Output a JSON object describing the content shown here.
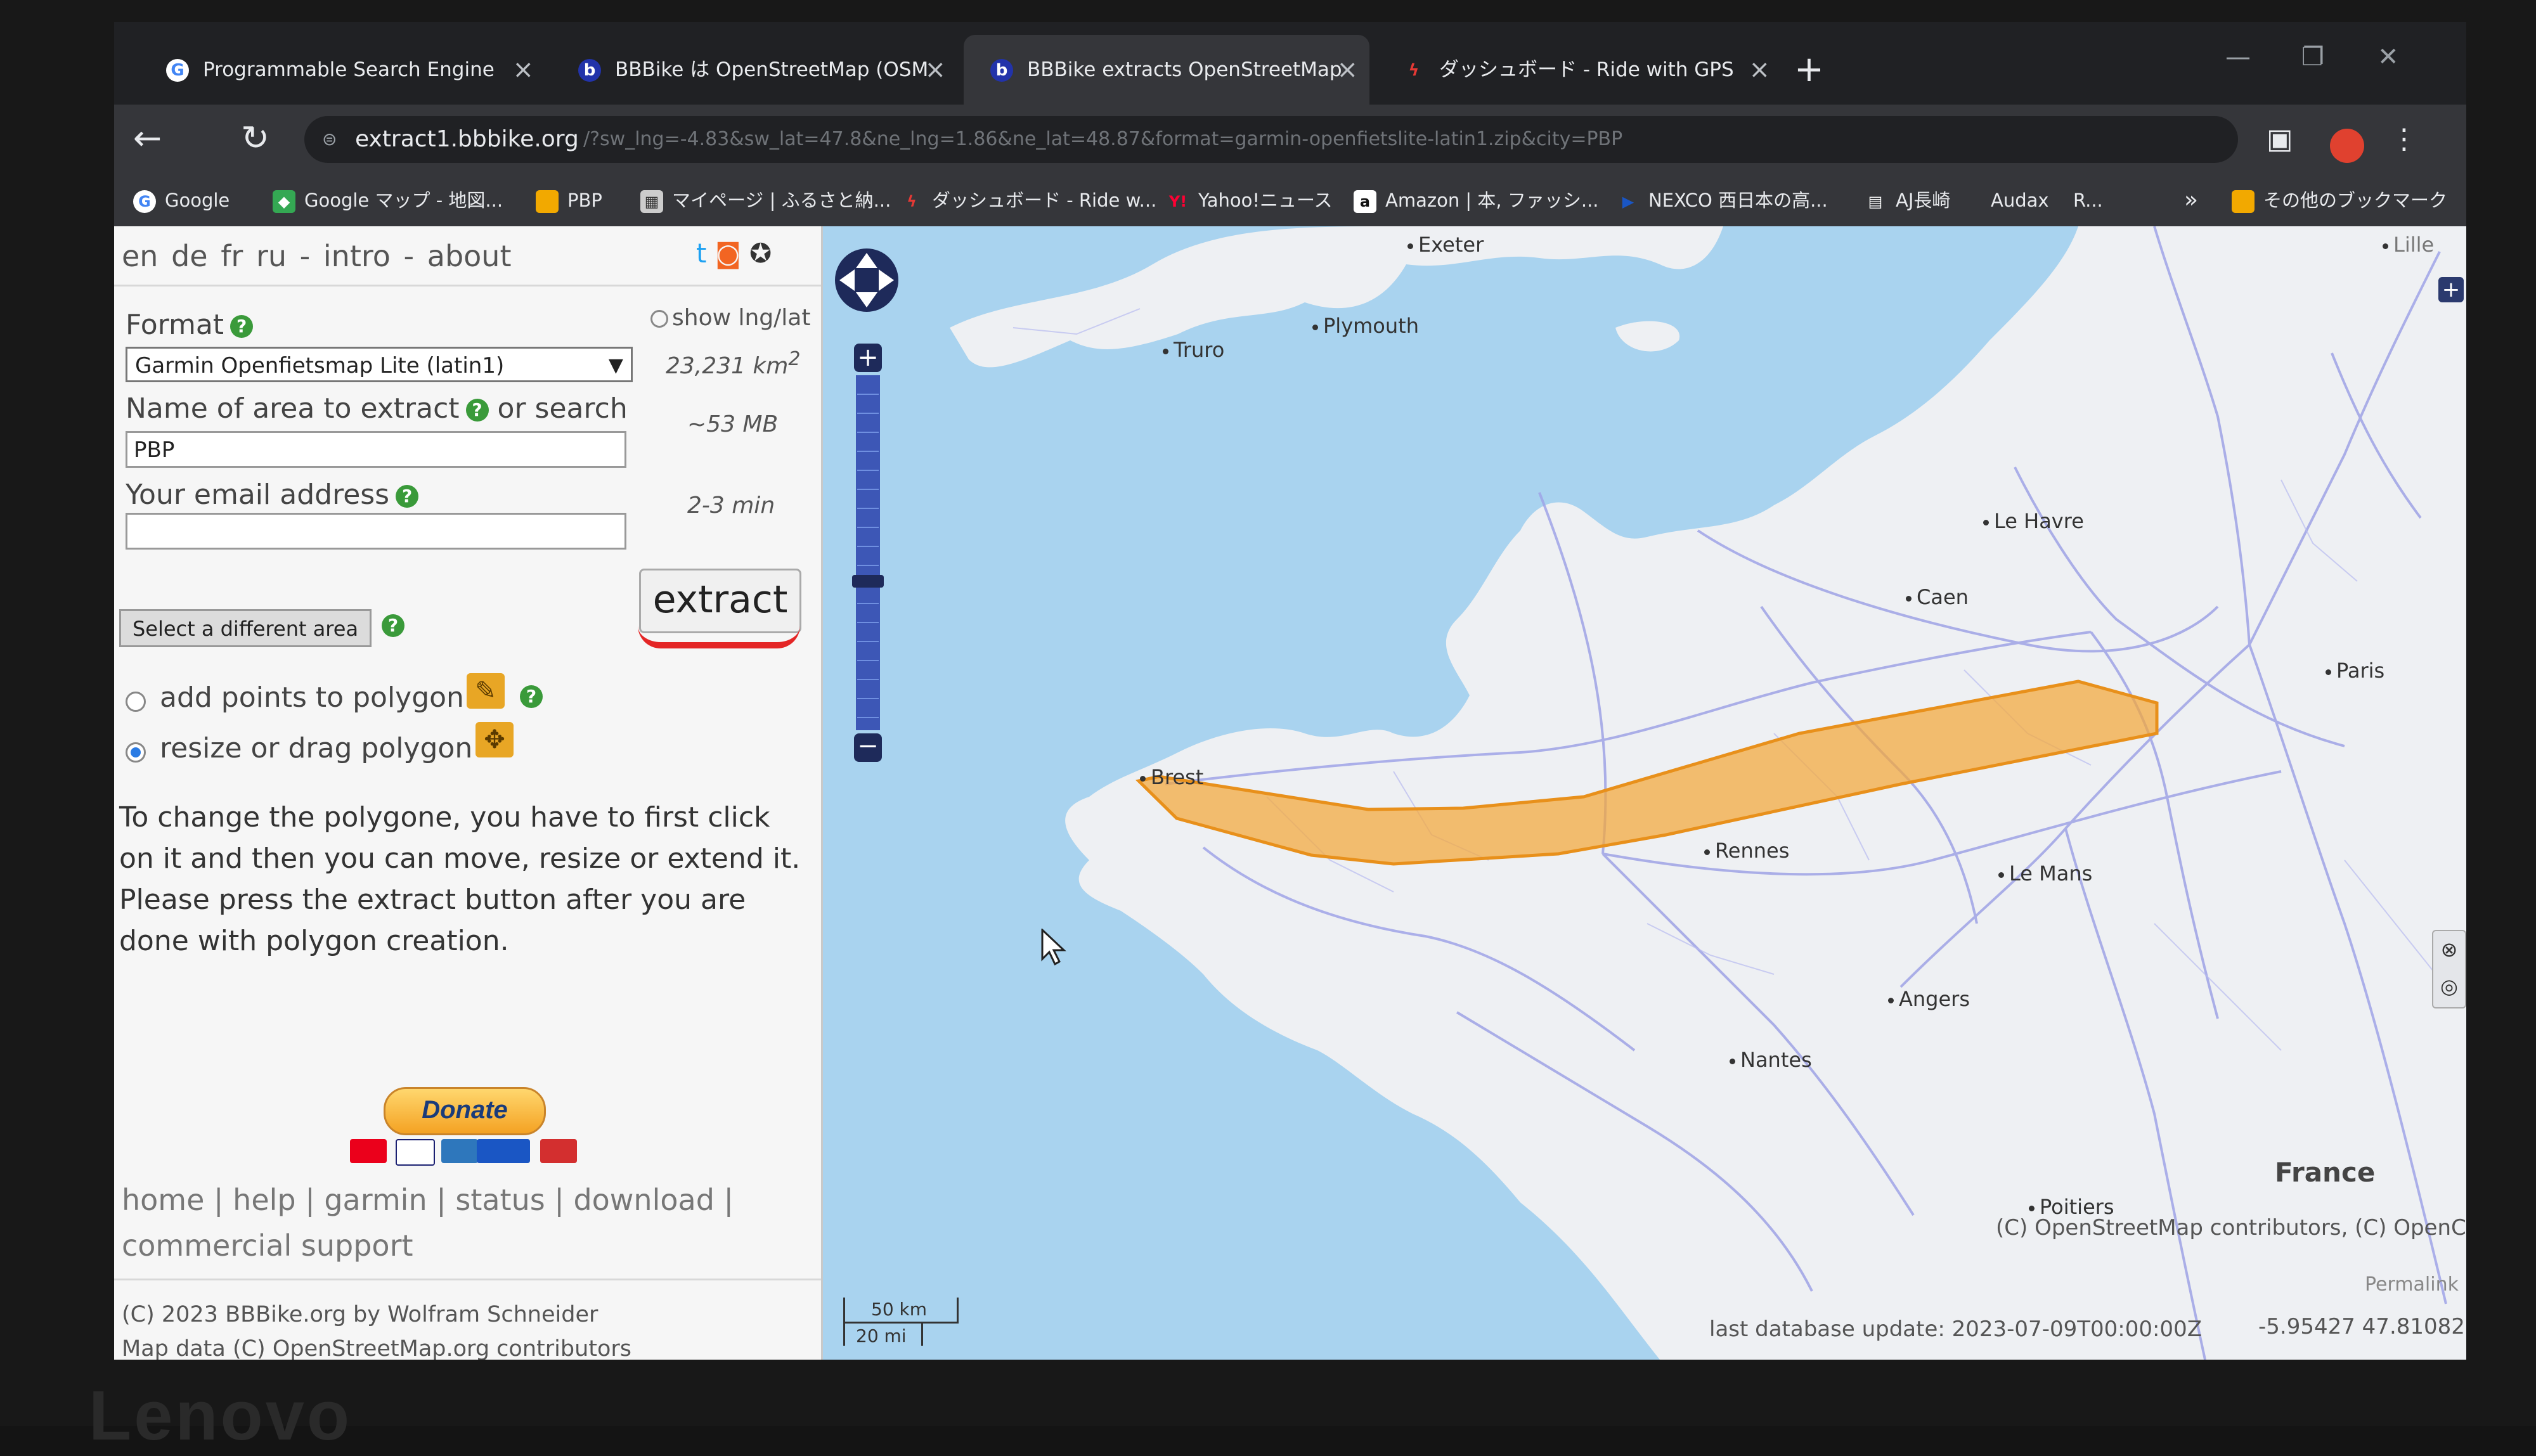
{
  "browser": {
    "tabs": [
      {
        "title": "Programmable Search Engine",
        "active": false
      },
      {
        "title": "BBBike は OpenStreetMap (OSM",
        "active": false
      },
      {
        "title": "BBBike extracts OpenStreetMap",
        "active": true
      },
      {
        "title": "ダッシュボード - Ride with GPS",
        "active": false
      }
    ],
    "url": "extract1.bbbike.org",
    "url_rest": "/?sw_lng=-4.83&sw_lat=47.8&ne_lng=1.86&ne_lat=48.87&format=garmin-openfietslite-latin1.zip&city=PBP",
    "bookmarks": [
      "Google",
      "Google マップ - 地図...",
      "PBP",
      "マイページ | ふるさと納...",
      "ダッシュボード - Ride w...",
      "Yahoo!ニュース",
      "Amazon | 本, ファッシ...",
      "NEXCO 西日本の高...",
      "AJ長崎",
      "Audax",
      "R...",
      "»",
      "その他のブックマーク"
    ]
  },
  "panel": {
    "languages": [
      "en",
      "de",
      "fr",
      "ru"
    ],
    "nav_intro": "intro",
    "nav_about": "about",
    "dash": "-",
    "format_label": "Format",
    "show_lnglat": "show lng/lat",
    "format_value": "Garmin Openfietsmap Lite (latin1)",
    "area_size": "23,231 km",
    "area_unit_sup": "2",
    "name_label": "Name of area to extract",
    "or_search": "or search",
    "file_size": "~53 MB",
    "name_value": "PBP",
    "email_label": "Your email address",
    "duration": "2-3 min",
    "email_value": "",
    "extract_label": "extract",
    "select_area_label": "Select a different area",
    "add_points_label": "add points to polygon",
    "resize_label": "resize or drag polygon",
    "instructions": "To change the polygone, you have to first click on it and then you can move, resize or extend it. Please press the extract button after you are done with polygon creation.",
    "donate_label": "Donate",
    "footer": [
      "home",
      "help",
      "garmin",
      "status",
      "download",
      "commercial support"
    ],
    "footer_sep": "|",
    "copyright_line1": "(C) 2023 BBBike.org by Wolfram Schneider",
    "copyright_line2": "Map data (C) OpenStreetMap.org contributors"
  },
  "map": {
    "cities": [
      "Exeter",
      "Plymouth",
      "Truro",
      "Le Havre",
      "Caen",
      "Paris",
      "Brest",
      "Rennes",
      "Le Mans",
      "Angers",
      "Nantes",
      "Poitiers",
      "Lille"
    ],
    "country": "France",
    "attribution": "(C) OpenStreetMap contributors, (C) OpenCycleMap",
    "permalink": "Permalink",
    "last_update": "last database update: 2023-07-09T00:00:00Z",
    "coords": "-5.95427  47.81082",
    "scale_km": "50 km",
    "scale_mi": "20 mi",
    "colors": {
      "polygon_fill": "#f4a73a",
      "polygon_stroke": "#e8901b",
      "water": "#a9d3ef",
      "land": "#eef0f3",
      "roads": "#8f92e0"
    }
  }
}
